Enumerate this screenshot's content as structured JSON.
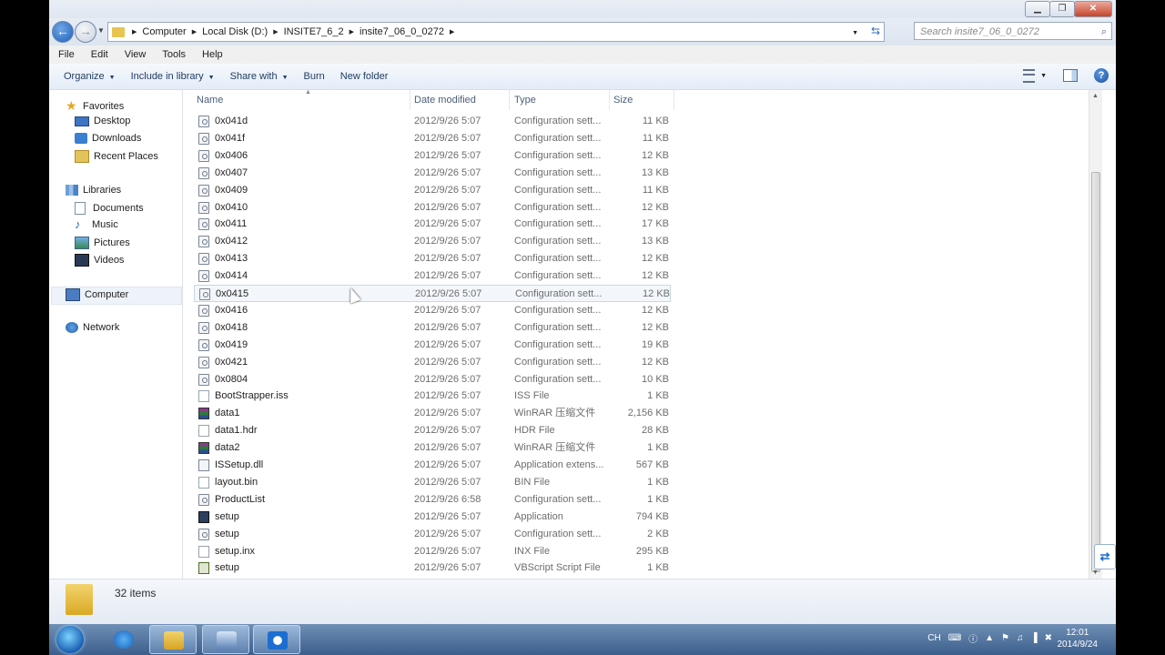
{
  "window": {
    "caption_buttons": {
      "minimize": "▁",
      "restore": "❐",
      "close": "✕"
    }
  },
  "address": {
    "breadcrumbs": [
      "Computer",
      "Local Disk (D:)",
      "INSITE7_6_2",
      "insite7_06_0_0272"
    ],
    "search_placeholder": "Search insite7_06_0_0272"
  },
  "menu": [
    "File",
    "Edit",
    "View",
    "Tools",
    "Help"
  ],
  "toolbar": {
    "organize": "Organize",
    "include": "Include in library",
    "share": "Share with",
    "burn": "Burn",
    "new_folder": "New folder"
  },
  "nav": {
    "favorites": {
      "label": "Favorites",
      "items": [
        "Desktop",
        "Downloads",
        "Recent Places"
      ]
    },
    "libraries": {
      "label": "Libraries",
      "items": [
        "Documents",
        "Music",
        "Pictures",
        "Videos"
      ]
    },
    "computer": "Computer",
    "network": "Network"
  },
  "columns": {
    "name": "Name",
    "date": "Date modified",
    "type": "Type",
    "size": "Size"
  },
  "files": [
    {
      "name": "0x041d",
      "date": "2012/9/26 5:07",
      "type": "Configuration sett...",
      "size": "11 KB",
      "icon": "cfg"
    },
    {
      "name": "0x041f",
      "date": "2012/9/26 5:07",
      "type": "Configuration sett...",
      "size": "11 KB",
      "icon": "cfg"
    },
    {
      "name": "0x0406",
      "date": "2012/9/26 5:07",
      "type": "Configuration sett...",
      "size": "12 KB",
      "icon": "cfg"
    },
    {
      "name": "0x0407",
      "date": "2012/9/26 5:07",
      "type": "Configuration sett...",
      "size": "13 KB",
      "icon": "cfg"
    },
    {
      "name": "0x0409",
      "date": "2012/9/26 5:07",
      "type": "Configuration sett...",
      "size": "11 KB",
      "icon": "cfg"
    },
    {
      "name": "0x0410",
      "date": "2012/9/26 5:07",
      "type": "Configuration sett...",
      "size": "12 KB",
      "icon": "cfg"
    },
    {
      "name": "0x0411",
      "date": "2012/9/26 5:07",
      "type": "Configuration sett...",
      "size": "17 KB",
      "icon": "cfg"
    },
    {
      "name": "0x0412",
      "date": "2012/9/26 5:07",
      "type": "Configuration sett...",
      "size": "13 KB",
      "icon": "cfg"
    },
    {
      "name": "0x0413",
      "date": "2012/9/26 5:07",
      "type": "Configuration sett...",
      "size": "12 KB",
      "icon": "cfg"
    },
    {
      "name": "0x0414",
      "date": "2012/9/26 5:07",
      "type": "Configuration sett...",
      "size": "12 KB",
      "icon": "cfg"
    },
    {
      "name": "0x0415",
      "date": "2012/9/26 5:07",
      "type": "Configuration sett...",
      "size": "12 KB",
      "icon": "cfg",
      "hover": true
    },
    {
      "name": "0x0416",
      "date": "2012/9/26 5:07",
      "type": "Configuration sett...",
      "size": "12 KB",
      "icon": "cfg"
    },
    {
      "name": "0x0418",
      "date": "2012/9/26 5:07",
      "type": "Configuration sett...",
      "size": "12 KB",
      "icon": "cfg"
    },
    {
      "name": "0x0419",
      "date": "2012/9/26 5:07",
      "type": "Configuration sett...",
      "size": "19 KB",
      "icon": "cfg"
    },
    {
      "name": "0x0421",
      "date": "2012/9/26 5:07",
      "type": "Configuration sett...",
      "size": "12 KB",
      "icon": "cfg"
    },
    {
      "name": "0x0804",
      "date": "2012/9/26 5:07",
      "type": "Configuration sett...",
      "size": "10 KB",
      "icon": "cfg"
    },
    {
      "name": "BootStrapper.iss",
      "date": "2012/9/26 5:07",
      "type": "ISS File",
      "size": "1 KB",
      "icon": "blank"
    },
    {
      "name": "data1",
      "date": "2012/9/26 5:07",
      "type": "WinRAR 压缩文件",
      "size": "2,156 KB",
      "icon": "rar"
    },
    {
      "name": "data1.hdr",
      "date": "2012/9/26 5:07",
      "type": "HDR File",
      "size": "28 KB",
      "icon": "blank"
    },
    {
      "name": "data2",
      "date": "2012/9/26 5:07",
      "type": "WinRAR 压缩文件",
      "size": "1 KB",
      "icon": "rar"
    },
    {
      "name": "ISSetup.dll",
      "date": "2012/9/26 5:07",
      "type": "Application extens...",
      "size": "567 KB",
      "icon": "dll"
    },
    {
      "name": "layout.bin",
      "date": "2012/9/26 5:07",
      "type": "BIN File",
      "size": "1 KB",
      "icon": "blank"
    },
    {
      "name": "ProductList",
      "date": "2012/9/26 6:58",
      "type": "Configuration sett...",
      "size": "1 KB",
      "icon": "cfg"
    },
    {
      "name": "setup",
      "date": "2012/9/26 5:07",
      "type": "Application",
      "size": "794 KB",
      "icon": "app"
    },
    {
      "name": "setup",
      "date": "2012/9/26 5:07",
      "type": "Configuration sett...",
      "size": "2 KB",
      "icon": "cfg"
    },
    {
      "name": "setup.inx",
      "date": "2012/9/26 5:07",
      "type": "INX File",
      "size": "295 KB",
      "icon": "blank"
    },
    {
      "name": "setup",
      "date": "2012/9/26 5:07",
      "type": "VBScript Script File",
      "size": "1 KB",
      "icon": "vbs"
    }
  ],
  "status": {
    "items": "32 items"
  },
  "taskbar": {
    "tray": {
      "lang": "CH"
    },
    "clock": {
      "time": "12:01",
      "date": "2014/9/24"
    }
  }
}
